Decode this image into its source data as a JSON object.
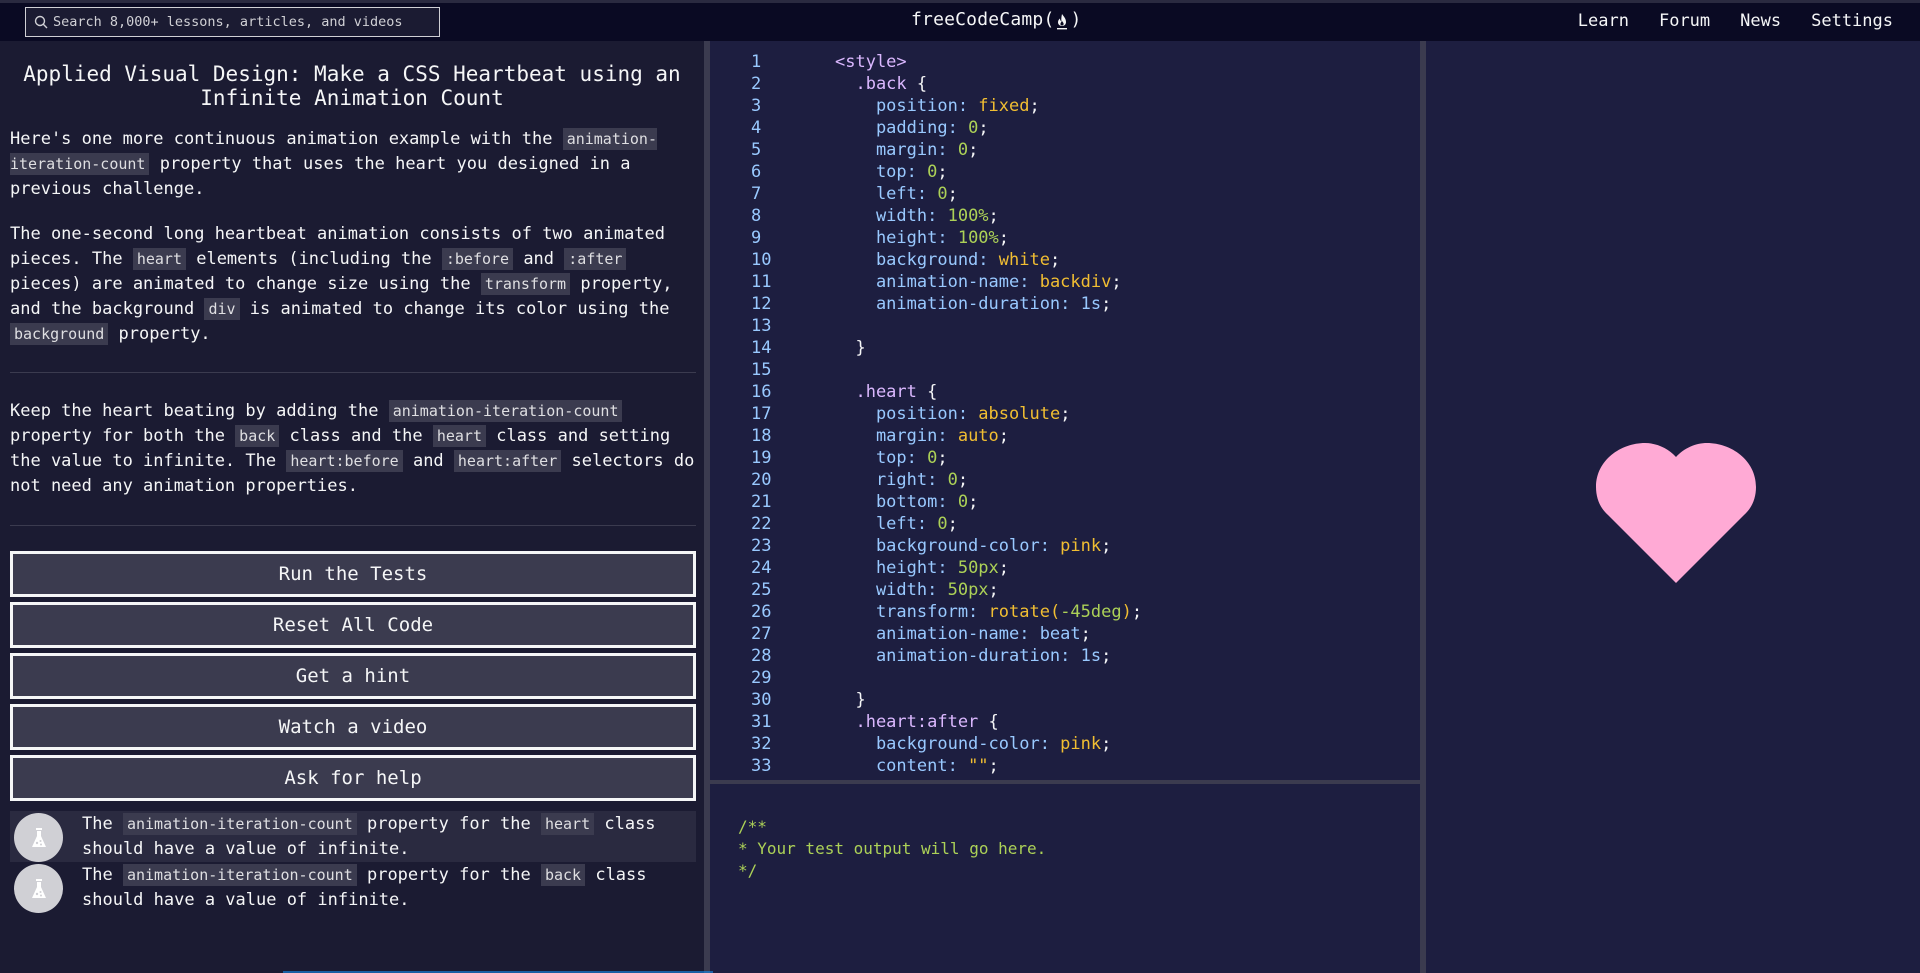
{
  "header": {
    "search_placeholder": "Search 8,000+ lessons, articles, and videos",
    "logo_prefix": "freeCodeCamp(",
    "logo_suffix": ")",
    "nav": [
      "Learn",
      "Forum",
      "News",
      "Settings"
    ]
  },
  "challenge": {
    "title": "Applied Visual Design: Make a CSS Heartbeat using an Infinite Animation Count",
    "p1": {
      "a": "Here's one more continuous animation example with the ",
      "code1": "animation-iteration-count",
      "b": " property that uses the heart you designed in a previous challenge."
    },
    "p2": {
      "a": "The one-second long heartbeat animation consists of two animated pieces. The ",
      "code1": "heart",
      "b": " elements (including the ",
      "code2": ":before",
      "c": " and ",
      "code3": ":after",
      "d": " pieces) are animated to change size using the ",
      "code4": "transform",
      "e": " property, and the background ",
      "code5": "div",
      "f": " is animated to change its color using the ",
      "code6": "background",
      "g": " property."
    },
    "p3": {
      "a": "Keep the heart beating by adding the ",
      "code1": "animation-iteration-count",
      "b": " property for both the ",
      "code2": "back",
      "c": " class and the ",
      "code3": "heart",
      "d": " class and setting the value to infinite. The ",
      "code4": "heart:before",
      "e": " and ",
      "code5": "heart:after",
      "f": " selectors do not need any animation properties."
    }
  },
  "buttons": {
    "run": "Run the Tests",
    "reset": "Reset All Code",
    "hint": "Get a hint",
    "video": "Watch a video",
    "help": "Ask for help"
  },
  "tests": [
    {
      "a": "The ",
      "code1": "animation-iteration-count",
      "b": " property for the ",
      "code2": "heart",
      "c": " class should have a value of infinite."
    },
    {
      "a": "The ",
      "code1": "animation-iteration-count",
      "b": " property for the ",
      "code2": "back",
      "c": " class should have a value of infinite."
    }
  ],
  "editor": {
    "lines": [
      [
        [
          "tag",
          "<style>"
        ]
      ],
      [
        [
          "sel",
          "  .back "
        ],
        [
          "punc",
          "{"
        ]
      ],
      [
        [
          "prop",
          "    position: "
        ],
        [
          "val",
          "fixed"
        ],
        [
          "punc",
          ";"
        ]
      ],
      [
        [
          "prop",
          "    padding: "
        ],
        [
          "num",
          "0"
        ],
        [
          "punc",
          ";"
        ]
      ],
      [
        [
          "prop",
          "    margin: "
        ],
        [
          "num",
          "0"
        ],
        [
          "punc",
          ";"
        ]
      ],
      [
        [
          "prop",
          "    top: "
        ],
        [
          "num",
          "0"
        ],
        [
          "punc",
          ";"
        ]
      ],
      [
        [
          "prop",
          "    left: "
        ],
        [
          "num",
          "0"
        ],
        [
          "punc",
          ";"
        ]
      ],
      [
        [
          "prop",
          "    width: "
        ],
        [
          "num",
          "100%"
        ],
        [
          "punc",
          ";"
        ]
      ],
      [
        [
          "prop",
          "    height: "
        ],
        [
          "num",
          "100%"
        ],
        [
          "punc",
          ";"
        ]
      ],
      [
        [
          "prop",
          "    background: "
        ],
        [
          "val",
          "white"
        ],
        [
          "punc",
          ";"
        ]
      ],
      [
        [
          "prop",
          "    animation-name: "
        ],
        [
          "val",
          "backdiv"
        ],
        [
          "punc",
          ";"
        ]
      ],
      [
        [
          "prop",
          "    animation-duration: 1s"
        ],
        [
          "punc",
          ";"
        ]
      ],
      [
        [
          "prop",
          ""
        ]
      ],
      [
        [
          "punc",
          "  }"
        ]
      ],
      [
        [
          "prop",
          ""
        ]
      ],
      [
        [
          "sel",
          "  .heart "
        ],
        [
          "punc",
          "{"
        ]
      ],
      [
        [
          "prop",
          "    position: "
        ],
        [
          "val",
          "absolute"
        ],
        [
          "punc",
          ";"
        ]
      ],
      [
        [
          "prop",
          "    margin: "
        ],
        [
          "val",
          "auto"
        ],
        [
          "punc",
          ";"
        ]
      ],
      [
        [
          "prop",
          "    top: "
        ],
        [
          "num",
          "0"
        ],
        [
          "punc",
          ";"
        ]
      ],
      [
        [
          "prop",
          "    right: "
        ],
        [
          "num",
          "0"
        ],
        [
          "punc",
          ";"
        ]
      ],
      [
        [
          "prop",
          "    bottom: "
        ],
        [
          "num",
          "0"
        ],
        [
          "punc",
          ";"
        ]
      ],
      [
        [
          "prop",
          "    left: "
        ],
        [
          "num",
          "0"
        ],
        [
          "punc",
          ";"
        ]
      ],
      [
        [
          "prop",
          "    background-color: "
        ],
        [
          "val",
          "pink"
        ],
        [
          "punc",
          ";"
        ]
      ],
      [
        [
          "prop",
          "    height: "
        ],
        [
          "num",
          "50px"
        ],
        [
          "punc",
          ";"
        ]
      ],
      [
        [
          "prop",
          "    width: "
        ],
        [
          "num",
          "50px"
        ],
        [
          "punc",
          ";"
        ]
      ],
      [
        [
          "prop",
          "    transform: "
        ],
        [
          "val",
          "rotate("
        ],
        [
          "num",
          "-45deg"
        ],
        [
          "val",
          ")"
        ],
        [
          "punc",
          ";"
        ]
      ],
      [
        [
          "prop",
          "    animation-name: beat"
        ],
        [
          "punc",
          ";"
        ]
      ],
      [
        [
          "prop",
          "    animation-duration: 1s"
        ],
        [
          "punc",
          ";"
        ]
      ],
      [
        [
          "prop",
          ""
        ]
      ],
      [
        [
          "punc",
          "  }"
        ]
      ],
      [
        [
          "sel",
          "  .heart:after "
        ],
        [
          "punc",
          "{"
        ]
      ],
      [
        [
          "prop",
          "    background-color: "
        ],
        [
          "val",
          "pink"
        ],
        [
          "punc",
          ";"
        ]
      ],
      [
        [
          "prop",
          "    content: "
        ],
        [
          "val",
          "\"\""
        ],
        [
          "punc",
          ";"
        ]
      ]
    ]
  },
  "output": {
    "text": "/**\n* Your test output will go here.\n*/"
  },
  "preview": {
    "heart_color": "#ffaad5"
  },
  "colors": {
    "nav_bg": "#0a0a23",
    "panel_bg": "#1b1b32",
    "editor_bg": "#1d1e40",
    "button_bg": "#3b3b4f",
    "comment_green": "#acd157",
    "line_number": "#99c9ff"
  }
}
